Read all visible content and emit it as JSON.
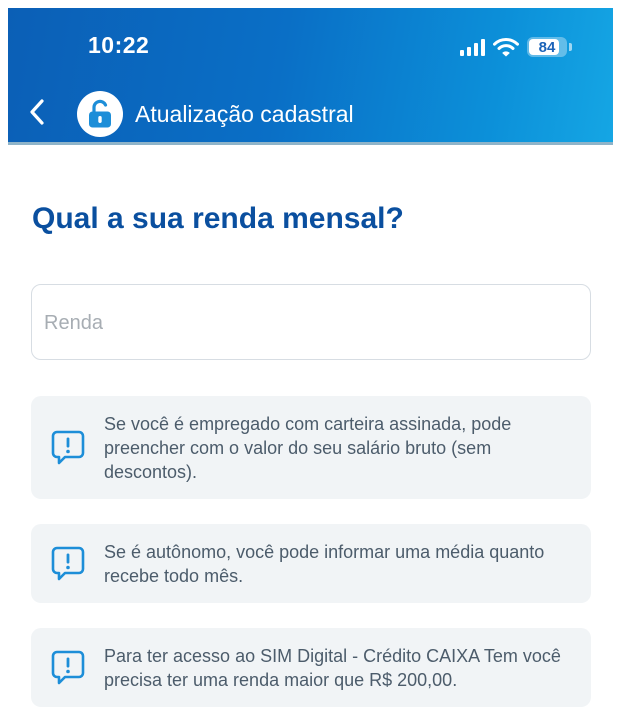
{
  "status_bar": {
    "time": "10:22",
    "battery": "84",
    "battery_level": 0.84
  },
  "header": {
    "title": "Atualização cadastral",
    "back_icon": "chevron-left-icon",
    "lock_icon": "lock-open-icon"
  },
  "main": {
    "question": "Qual a sua renda mensal?",
    "income_field": {
      "placeholder": "Renda",
      "value": ""
    }
  },
  "info_cards": [
    {
      "icon": "alert-speech-icon",
      "text": "Se você é empregado com carteira assinada, pode preencher com o valor do seu salário bruto (sem descontos)."
    },
    {
      "icon": "alert-speech-icon",
      "text": "Se é autônomo, você pode informar uma média quanto recebe todo mês."
    },
    {
      "icon": "alert-speech-icon",
      "text": "Para ter acesso ao SIM Digital - Crédito CAIXA Tem você precisa ter uma renda maior que R$ 200,00."
    }
  ],
  "colors": {
    "header_gradient_start": "#0b5fb6",
    "header_gradient_end": "#15a6e4",
    "title_blue": "#0a4f9f",
    "card_background": "#f1f4f6",
    "icon_blue": "#1d8ed8"
  }
}
